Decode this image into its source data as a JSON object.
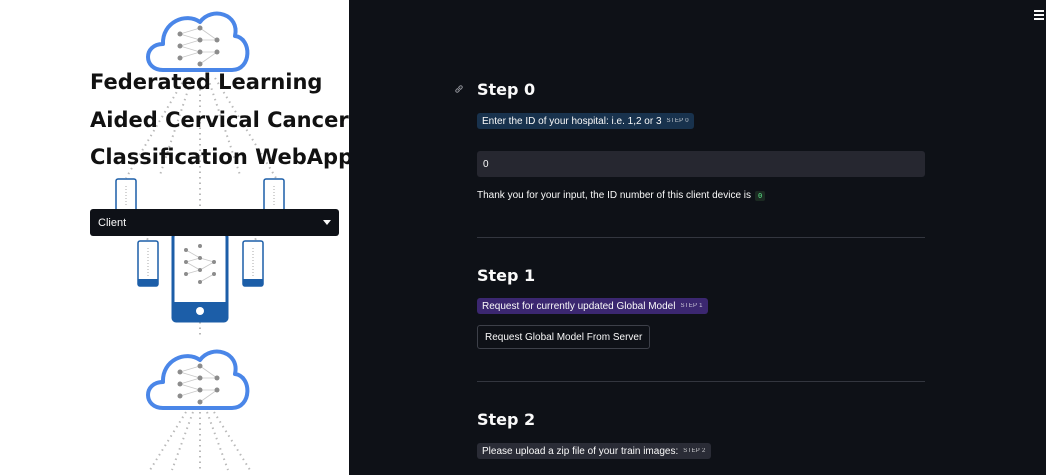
{
  "sidebar": {
    "title_lines": [
      "Federated Learning",
      "Aided Cervical Cancer",
      "Classification WebApp"
    ],
    "mode_select": {
      "value": "Client"
    }
  },
  "main": {
    "steps": [
      {
        "heading": "Step 0",
        "badge": "Enter the ID of your hospital: i.e. 1,2 or 3",
        "badge_tag": "STEP 0"
      },
      {
        "heading": "Step 1",
        "badge": "Request for currently updated Global Model",
        "badge_tag": "STEP 1"
      },
      {
        "heading": "Step 2",
        "badge": "Please upload a zip file of your train images:",
        "badge_tag": "STEP 2"
      }
    ],
    "id_input": {
      "value": "0"
    },
    "confirmation": {
      "text": "Thank you for your input, the ID number of this client device is",
      "value": "0"
    },
    "request_button": {
      "label": "Request Global Model From Server"
    }
  },
  "icons": [
    "menu-icon",
    "link-icon",
    "chevron-down-icon",
    "cloud-network-icon",
    "phone-icon"
  ],
  "colors": {
    "main_bg": "#0e1117",
    "sidebar_bg": "#ffffff",
    "cloud_blue": "#4a86e8",
    "phone_blue": "#1c5ea8",
    "badge_blue": "#18324d",
    "badge_purple": "#3b2770",
    "badge_gray": "#2a2c36",
    "code_green": "#5ce488"
  }
}
